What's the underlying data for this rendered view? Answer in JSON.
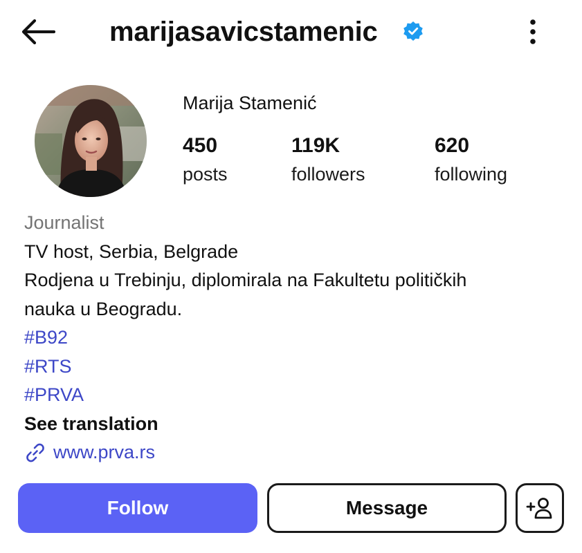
{
  "header": {
    "username": "marijasavicstamenic",
    "back_icon": "back-arrow-icon",
    "verified_icon": "verified-badge-icon",
    "more_icon": "more-options-icon"
  },
  "profile": {
    "display_name": "Marija Stamenić",
    "avatar": "profile-photo",
    "stats": [
      {
        "value": "450",
        "label": "posts"
      },
      {
        "value": "119K",
        "label": "followers"
      },
      {
        "value": "620",
        "label": "following"
      }
    ]
  },
  "bio": {
    "category": "Journalist",
    "lines": [
      "TV host, Serbia, Belgrade",
      "Rodjena u Trebinju, diplomirala na Fakultetu političkih",
      "nauka u Beogradu."
    ],
    "hashtags": [
      "#B92",
      "#RTS",
      "#PRVA"
    ],
    "see_translation": "See translation",
    "link_icon": "link-icon",
    "link": "www.prva.rs"
  },
  "actions": {
    "follow": "Follow",
    "message": "Message",
    "add_user_icon": "add-user-icon"
  },
  "colors": {
    "accent": "#5b62f5",
    "verified": "#1d9bf0",
    "hashtag": "#3d47c7",
    "category": "#737373"
  }
}
